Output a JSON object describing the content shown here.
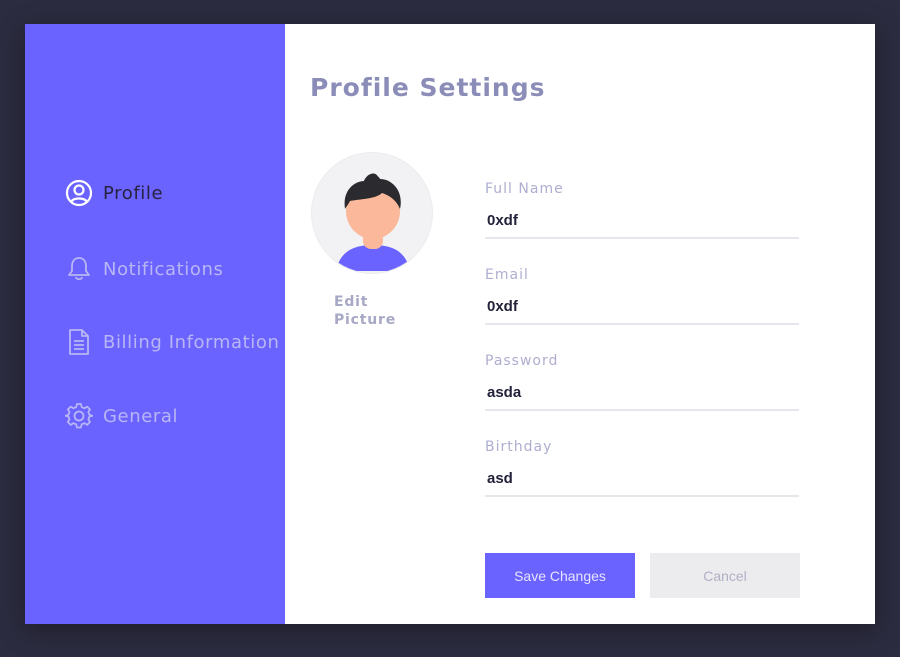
{
  "sidebar": {
    "items": [
      {
        "label": "Profile",
        "icon": "user-circle-icon",
        "active": true
      },
      {
        "label": "Notifications",
        "icon": "bell-icon",
        "active": false
      },
      {
        "label": "Billing Information",
        "icon": "document-icon",
        "active": false
      },
      {
        "label": "General",
        "icon": "gear-icon",
        "active": false
      }
    ]
  },
  "main": {
    "title": "Profile Settings",
    "avatar": {
      "edit_label": "Edit Picture"
    },
    "fields": [
      {
        "label": "Full Name",
        "value": "0xdf"
      },
      {
        "label": "Email",
        "value": "0xdf"
      },
      {
        "label": "Password",
        "value": "asda"
      },
      {
        "label": "Birthday",
        "value": "asd"
      }
    ],
    "buttons": {
      "save_label": "Save Changes",
      "cancel_label": "Cancel"
    }
  },
  "colors": {
    "accent": "#6b63ff",
    "background": "#2c2c40",
    "title": "#8b8db8",
    "active_nav": "#27233f",
    "inactive_nav": "#b8b6f4"
  }
}
